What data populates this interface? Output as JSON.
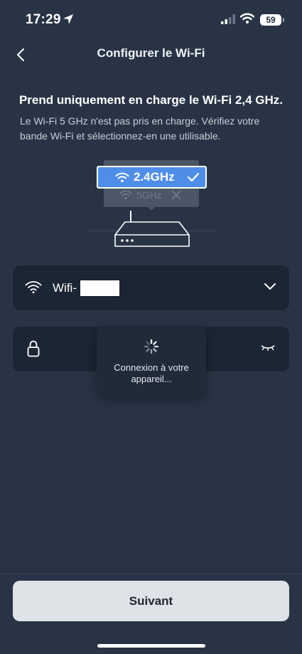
{
  "status_bar": {
    "time": "17:29",
    "battery": "59",
    "icons": [
      "location-arrow-icon",
      "signal-icon",
      "wifi-icon",
      "battery-icon"
    ]
  },
  "nav": {
    "title": "Configurer le Wi-Fi",
    "back_icon": "chevron-left-icon"
  },
  "content": {
    "headline": "Prend uniquement en charge le Wi-Fi 2,4 GHz.",
    "subtext": "Le Wi-Fi 5 GHz n'est pas pris en charge. Vérifiez votre bande Wi-Fi et sélectionnez-en une utilisable."
  },
  "illustration": {
    "band_supported": "2.4GHz",
    "band_unsupported": "5GHz",
    "supported_color": "#4f8ee8"
  },
  "form": {
    "ssid_value": "Wifi-",
    "ssid_icon": "wifi-icon",
    "dropdown_icon": "chevron-down-icon",
    "password_icon": "lock-icon",
    "visibility_icon": "eye-closed-icon"
  },
  "toast": {
    "message": "Connexion à votre appareil...",
    "icon": "spinner-icon"
  },
  "footer": {
    "next_label": "Suivant"
  },
  "colors": {
    "background": "#283445",
    "field_background": "#1c2533",
    "button_background": "#dfe2e6"
  }
}
